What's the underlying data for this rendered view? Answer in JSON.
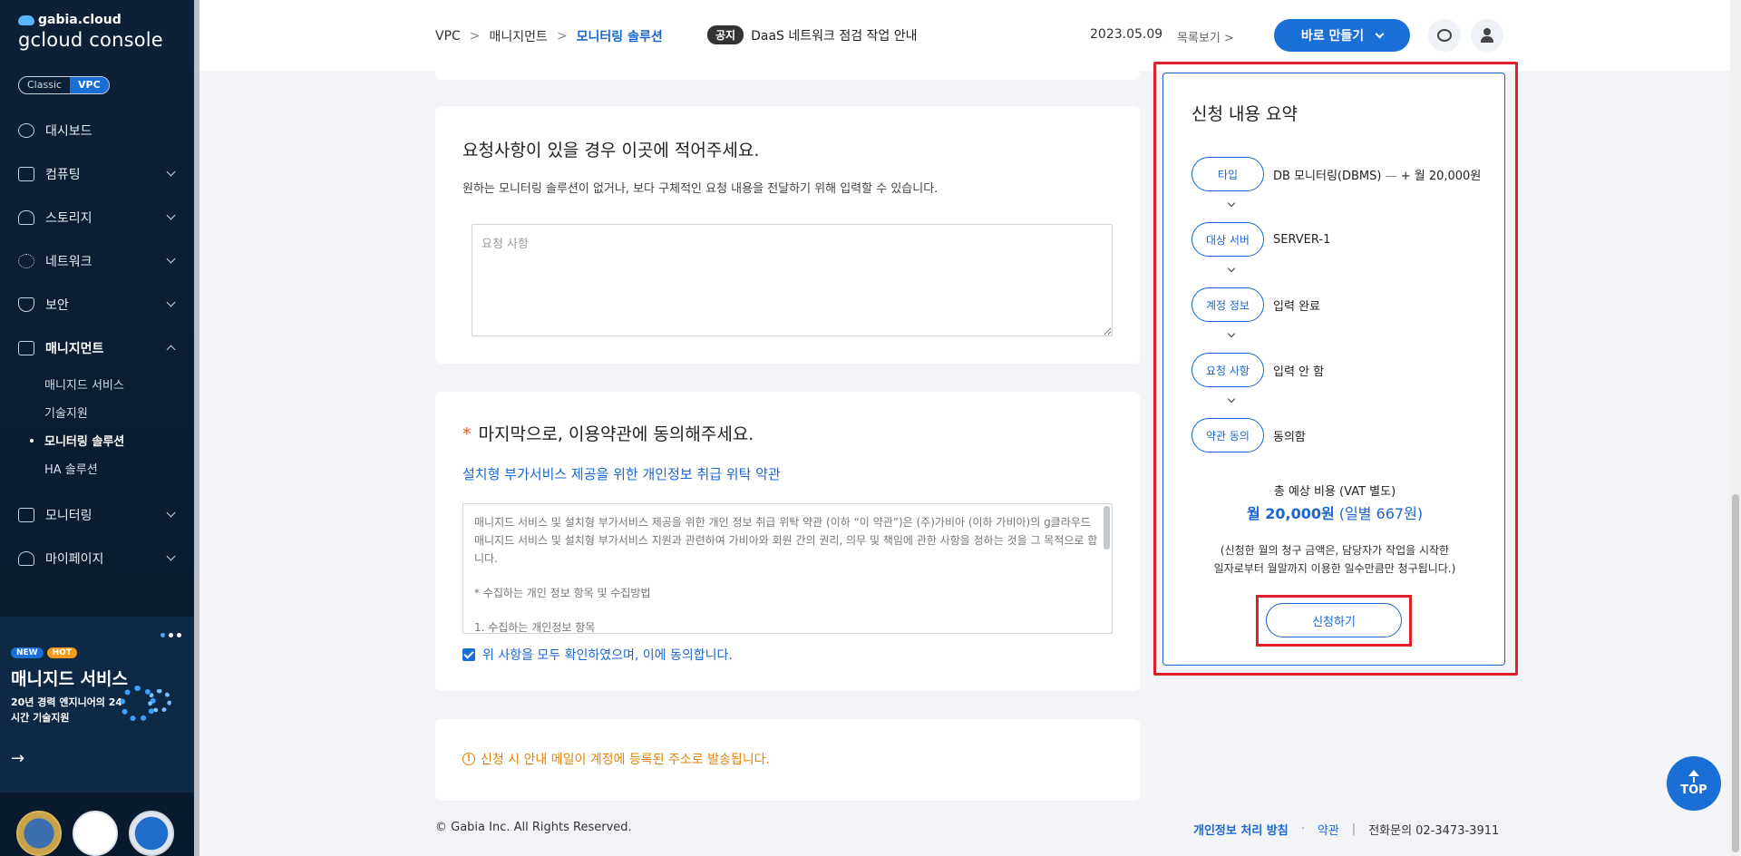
{
  "sidebar": {
    "brand": "gabia.cloud",
    "console": "gcloud console",
    "mode_classic": "Classic",
    "mode_vpc": "VPC",
    "items": [
      {
        "label": "대시보드"
      },
      {
        "label": "컴퓨팅"
      },
      {
        "label": "스토리지"
      },
      {
        "label": "네트워크"
      },
      {
        "label": "보안"
      },
      {
        "label": "매니지먼트"
      },
      {
        "label": "모니터링"
      },
      {
        "label": "마이페이지"
      }
    ],
    "sub_items": [
      {
        "label": "매니지드 서비스"
      },
      {
        "label": "기술지원"
      },
      {
        "label": "모니터링 솔루션"
      },
      {
        "label": "HA 솔루션"
      }
    ],
    "promo": {
      "badge_new": "NEW",
      "badge_hot": "HOT",
      "title": "매니지드 서비스",
      "desc": "20년 경력 엔지니어의 24시간 기술지원",
      "arrow": "→"
    }
  },
  "header": {
    "crumb_1": "VPC",
    "crumb_2": "매니지먼트",
    "crumb_3": "모니터링 솔루션",
    "sep": ">",
    "notice_tag": "공지",
    "notice_text": "DaaS 네트워크 점검 작업 안내",
    "notice_date": "2023.05.09",
    "notice_list": "목록보기 >",
    "make_button": "바로 만들기"
  },
  "request": {
    "title": "요청사항이 있을 경우 이곳에 적어주세요.",
    "desc": "원하는 모니터링 솔루션이 없거나, 보다 구체적인 요청 내용을 전달하기 위해 입력할 수 있습니다.",
    "placeholder": "요청 사항",
    "value": ""
  },
  "terms": {
    "star": "*",
    "title": "마지막으로, 이용약관에 동의해주세요.",
    "link": "설치형 부가서비스 제공을 위한 개인정보 취급 위탁 약관",
    "body_1": "매니지드 서비스 및 설치형 부가서비스 제공을 위한 개인 정보 취급 위탁 약관 (이하 “이 약관”)은 (주)가비아 (이하 가비아)의 g클라우드 매니지드 서비스 및 설치형 부가서비스 지원과 관련하여 가비아와 회원 간의 권리, 의무 및 책임에 관한 사항을 정하는 것을 그 목적으로 합니다.",
    "body_2": "* 수집하는 개인 정보 항목 및 수집방법",
    "body_3": "1. 수집하는 개인정보 항목",
    "agree": "위 사항을 모두 확인하였으며, 이에 동의합니다."
  },
  "info": {
    "warning_icon": "!",
    "warning": "신청 시 안내 메일이 계정에 등록된 주소로 발송됩니다."
  },
  "footer": {
    "copyright": "© Gabia Inc. All Rights Reserved.",
    "privacy": "개인정보 처리 방침",
    "dot": "·",
    "terms": "약관",
    "bar": "|",
    "tel": "전화문의  02-3473-3911"
  },
  "summary": {
    "title": "신청 내용 요약",
    "rows": [
      {
        "label": "타입",
        "value": "DB 모니터링(DBMS)",
        "extra": " — ",
        "price": "+ 월 20,000원"
      },
      {
        "label": "대상 서버",
        "value": "SERVER-1"
      },
      {
        "label": "계정 정보",
        "value": "입력 완료"
      },
      {
        "label": "요청 사항",
        "value": "입력 안 함"
      },
      {
        "label": "약관 동의",
        "value": "동의함"
      }
    ],
    "total_label": "총 예상 비용 (VAT 별도)",
    "total_value": "월 20,000원",
    "total_daily": " (일별 667원)",
    "note_1": "(신청한 월의 청구 금액은, 담당자가 작업을 시작한",
    "note_2": "일자로부터 월말까지 이용한 일수만큼만 청구됩니다.)",
    "apply": "신청하기"
  },
  "top_button": "TOP",
  "colors": {
    "accent": "#1a6fd6",
    "highlight": "#e0202a",
    "warning": "#e3830c",
    "sidebar_bg": "#0c2038"
  }
}
